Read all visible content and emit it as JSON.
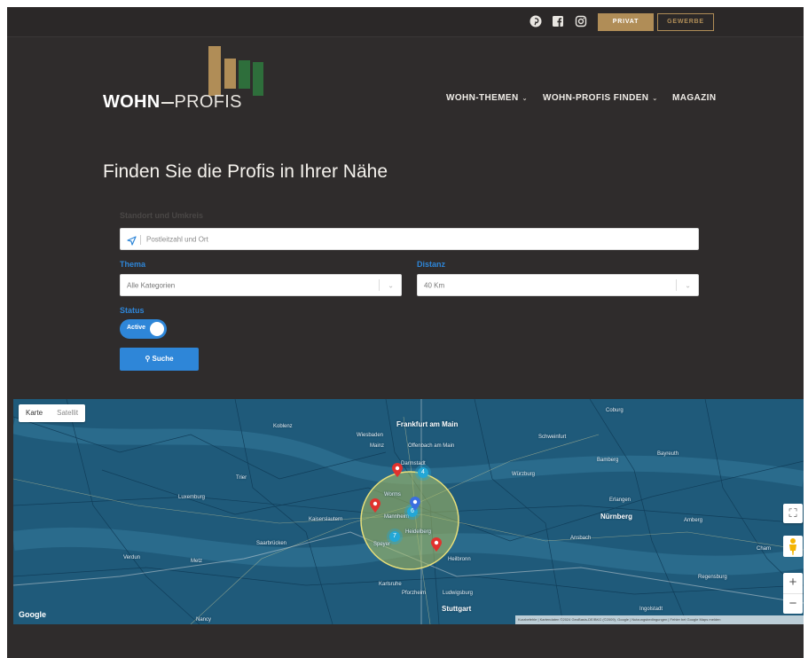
{
  "topbar": {
    "social_icons": [
      "pinterest-icon",
      "facebook-icon",
      "instagram-icon"
    ],
    "privat_label": "PRIVAT",
    "gewerbe_label": "GEWERBE"
  },
  "header": {
    "logo_strong": "WOHN",
    "logo_light": "PROFIS",
    "nav": [
      {
        "label": "WOHN-THEMEN",
        "has_dropdown": true
      },
      {
        "label": "WOHN-PROFIS FINDEN",
        "has_dropdown": true
      },
      {
        "label": "MAGAZIN",
        "has_dropdown": false
      }
    ]
  },
  "search": {
    "title": "Finden Sie die Profis in Ihrer Nähe",
    "location_label": "Standort und Umkreis",
    "location_placeholder": "Postleitzahl und Ort",
    "theme_label": "Thema",
    "theme_value": "Alle Kategorien",
    "distance_label": "Distanz",
    "distance_value": "40 Km",
    "status_label": "Status",
    "status_toggle": "Active",
    "submit_label": "Suche"
  },
  "map": {
    "type_options": [
      "Karte",
      "Satellit"
    ],
    "selected_type": "Karte",
    "attribution": "Kurzbefehle | Kartendaten ©2024 GeoBasis-DE/BKG (©2009), Google | Nutzungsbedingungen | Fehler bei Google Maps melden",
    "google": "Google",
    "cities": [
      {
        "name": "Frankfurt am Main",
        "big": true
      },
      {
        "name": "Mannheim",
        "big": false
      },
      {
        "name": "Heidelberg",
        "big": false
      },
      {
        "name": "Stuttgart",
        "big": true
      },
      {
        "name": "Nürnberg",
        "big": true
      },
      {
        "name": "Würzburg",
        "big": false
      },
      {
        "name": "Luxemburg",
        "big": false
      },
      {
        "name": "Karlsruhe",
        "big": false
      },
      {
        "name": "Kaiserslautern",
        "big": false
      },
      {
        "name": "Darmstadt",
        "big": false
      },
      {
        "name": "Wiesbaden",
        "big": false
      },
      {
        "name": "Mainz",
        "big": false
      },
      {
        "name": "Offenbach am Main",
        "big": false
      },
      {
        "name": "Saarbrücken",
        "big": false
      },
      {
        "name": "Metz",
        "big": false
      },
      {
        "name": "Pforzheim",
        "big": false
      },
      {
        "name": "Ludwigsburg",
        "big": false
      },
      {
        "name": "Heilbronn",
        "big": false
      },
      {
        "name": "Regensburg",
        "big": false
      },
      {
        "name": "Ingolstadt",
        "big": false
      },
      {
        "name": "Erlangen",
        "big": false
      },
      {
        "name": "Bamberg",
        "big": false
      },
      {
        "name": "Coburg",
        "big": false
      },
      {
        "name": "Trier",
        "big": false
      },
      {
        "name": "Koblenz",
        "big": false
      },
      {
        "name": "Nancy",
        "big": false
      },
      {
        "name": "Speyer",
        "big": false
      },
      {
        "name": "Worms",
        "big": false
      },
      {
        "name": "Verdun",
        "big": false
      },
      {
        "name": "Bayreuth",
        "big": false
      },
      {
        "name": "Schweinfurt",
        "big": false
      },
      {
        "name": "Ansbach",
        "big": false
      },
      {
        "name": "Amberg",
        "big": false
      },
      {
        "name": "Cham",
        "big": false
      }
    ],
    "clusters": [
      "4",
      "6",
      "7"
    ]
  }
}
